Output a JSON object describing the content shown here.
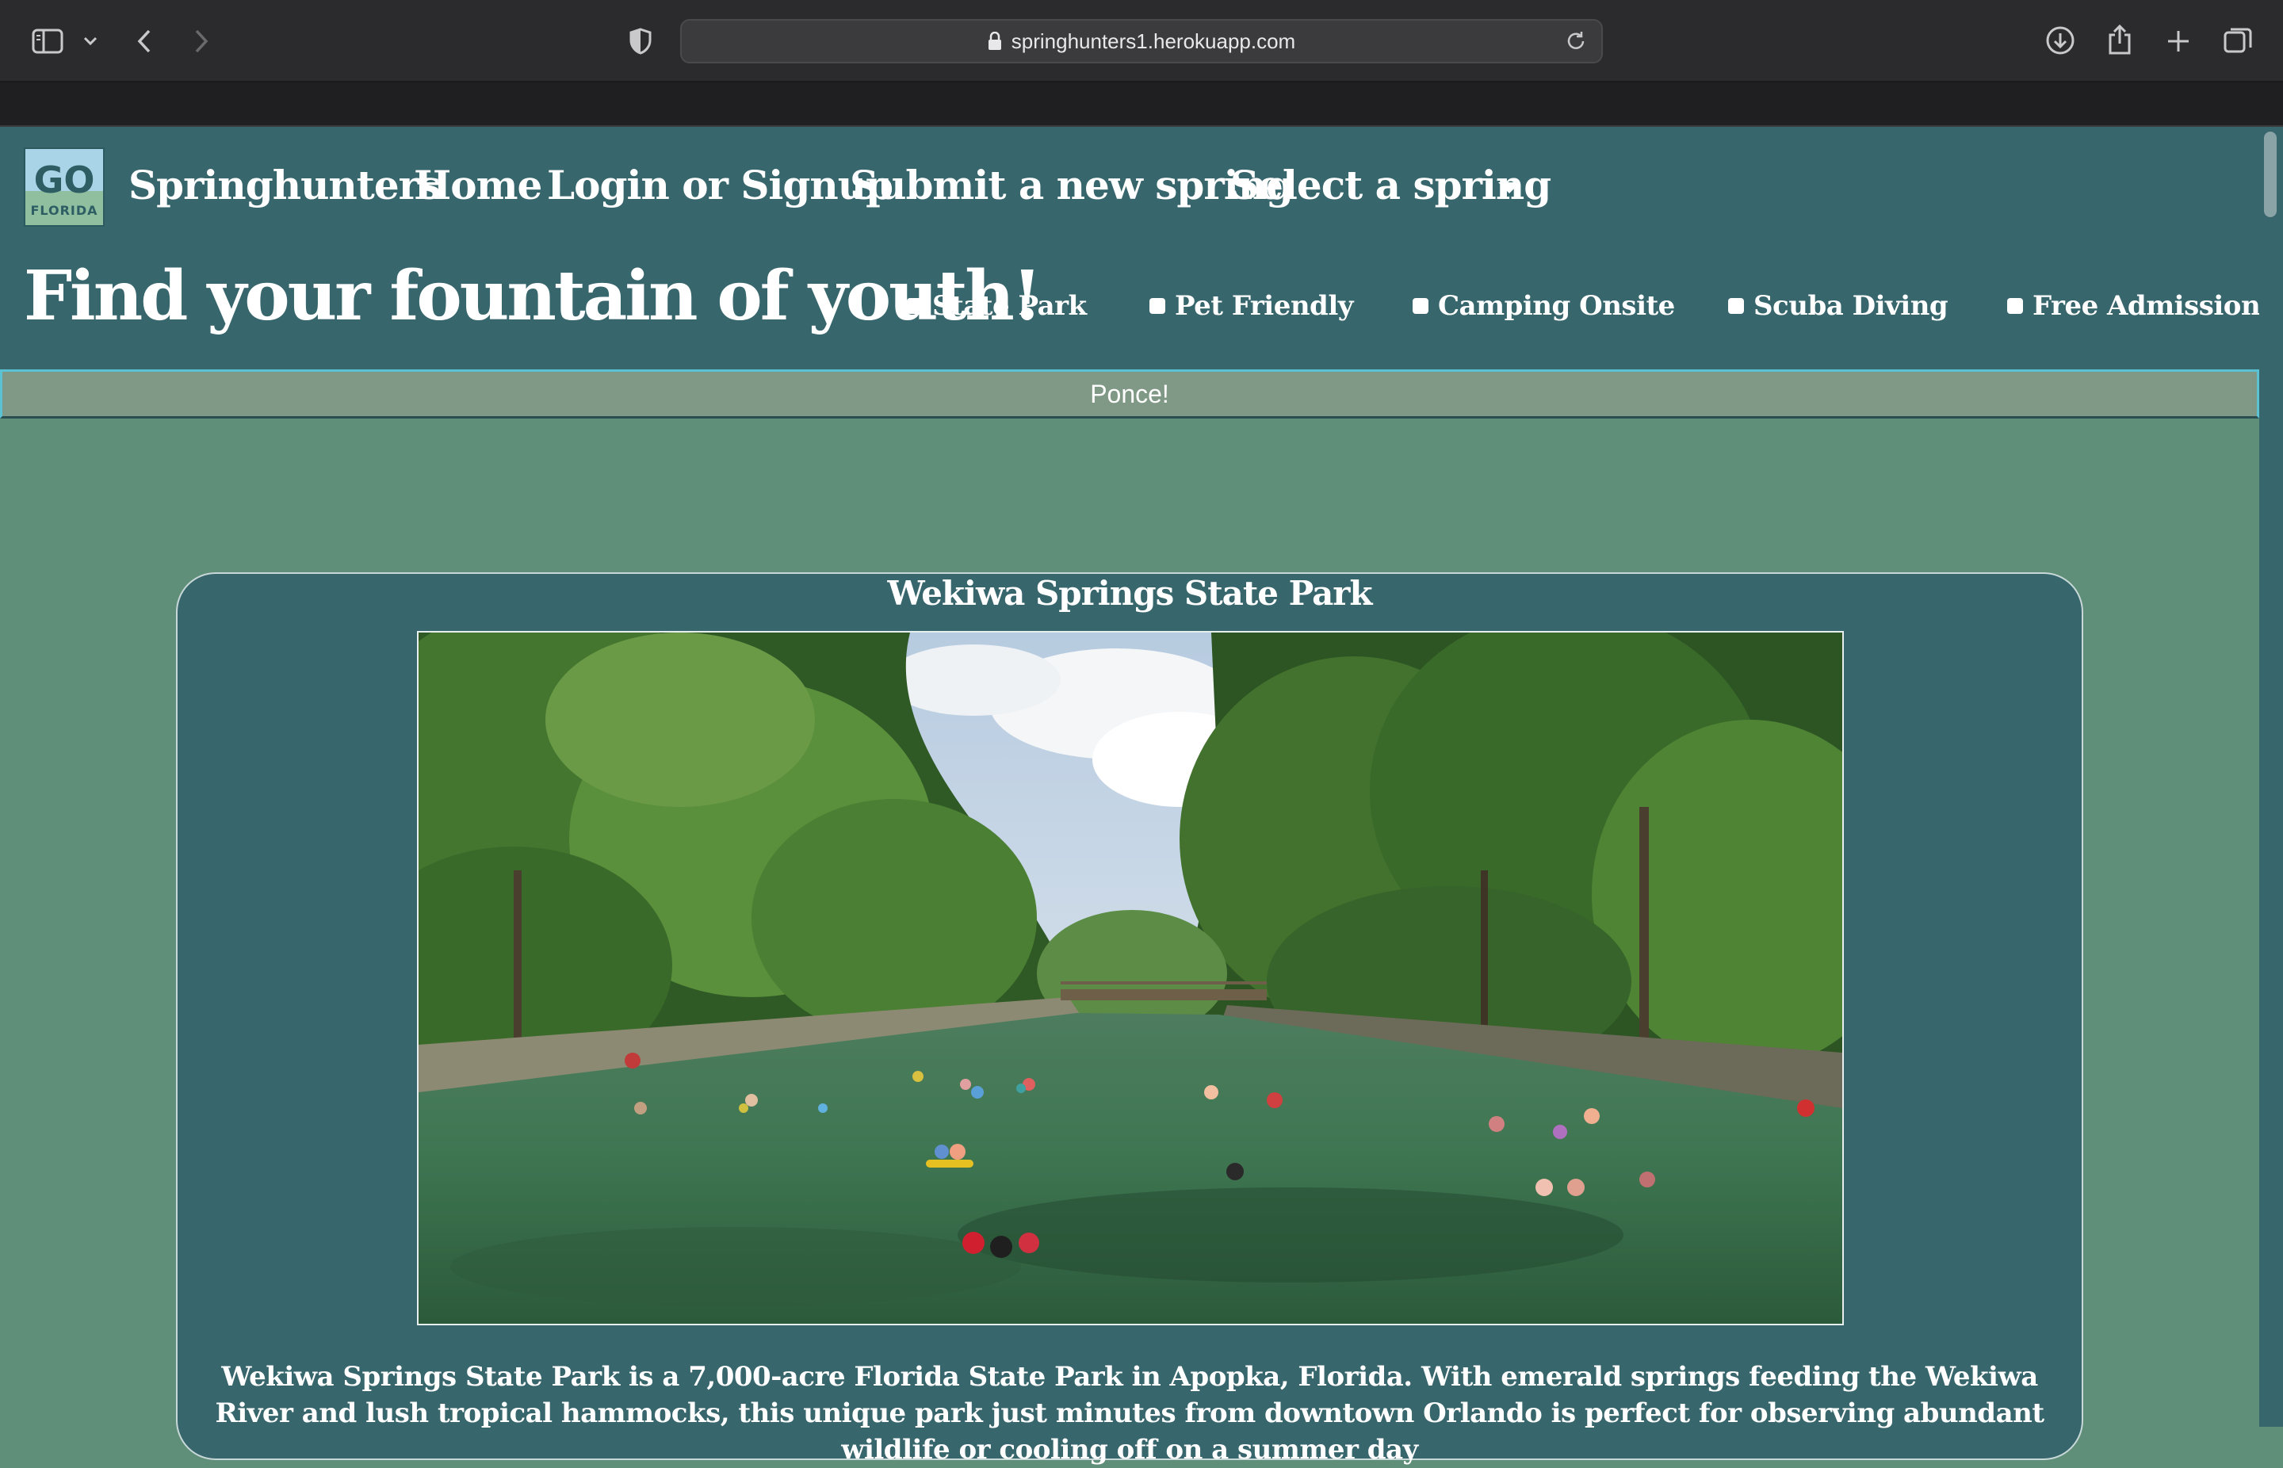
{
  "browser": {
    "url": "springhunters1.herokuapp.com"
  },
  "nav": {
    "brand": "Springhunters",
    "logo": {
      "top": "GO",
      "bottom": "FLORIDA"
    },
    "home": "Home",
    "login": "Login or Signup",
    "submit": "Submit a new spring",
    "select": "Select a spring"
  },
  "hero": {
    "title": "Find your fountain of youth!"
  },
  "filters": [
    {
      "label": "State Park",
      "checked": false
    },
    {
      "label": "Pet Friendly",
      "checked": false
    },
    {
      "label": "Camping Onsite",
      "checked": false
    },
    {
      "label": "Scuba Diving",
      "checked": false
    },
    {
      "label": "Free Admission",
      "checked": false
    }
  ],
  "ponce_button": "Ponce!",
  "spring_card": {
    "title": "Wekiwa Springs State Park",
    "description": "Wekiwa Springs State Park is a 7,000-acre Florida State Park in Apopka, Florida. With emerald springs feeding the Wekiwa River and lush tropical hammocks, this unique park just minutes from downtown Orlando is perfect for observing abundant wildlife or cooling off on a summer day"
  },
  "colors": {
    "page_bg": "#5f8f78",
    "header_bg": "#37666c",
    "ponce_bg": "#809986",
    "ponce_border": "#5bc2d4"
  }
}
